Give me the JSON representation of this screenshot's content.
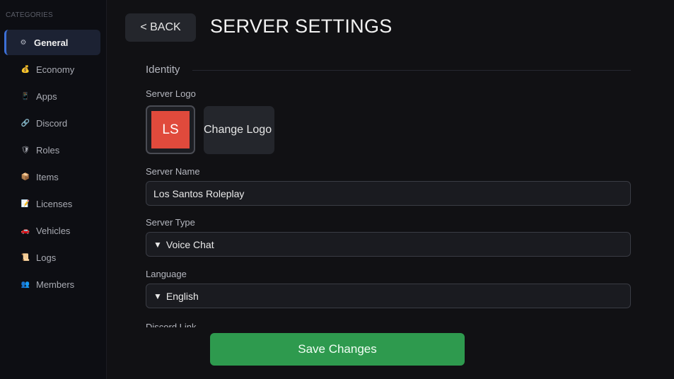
{
  "sidebar": {
    "categories_label": "CATEGORIES",
    "items": [
      {
        "label": "General",
        "icon": "gear-icon",
        "glyph": "⚙",
        "color": "#b8bcc8"
      },
      {
        "label": "Economy",
        "icon": "money-bag-icon",
        "glyph": "💰",
        "color": "#e8b64c"
      },
      {
        "label": "Apps",
        "icon": "phone-icon",
        "glyph": "📱",
        "color": "#9a6fd6"
      },
      {
        "label": "Discord",
        "icon": "link-icon",
        "glyph": "🔗",
        "color": "#9aa0ab"
      },
      {
        "label": "Roles",
        "icon": "shield-icon",
        "glyph": "🛡",
        "color": "#4a9be0"
      },
      {
        "label": "Items",
        "icon": "box-icon",
        "glyph": "📦",
        "color": "#d9a24a"
      },
      {
        "label": "Licenses",
        "icon": "document-icon",
        "glyph": "📝",
        "color": "#e07070"
      },
      {
        "label": "Vehicles",
        "icon": "car-icon",
        "glyph": "🚗",
        "color": "#d8504a"
      },
      {
        "label": "Logs",
        "icon": "scroll-icon",
        "glyph": "📜",
        "color": "#e0c27a"
      },
      {
        "label": "Members",
        "icon": "people-icon",
        "glyph": "👥",
        "color": "#8a6ab8"
      }
    ]
  },
  "header": {
    "back_label": "< BACK",
    "title": "SERVER SETTINGS"
  },
  "identity": {
    "section_title": "Identity",
    "logo_label": "Server Logo",
    "logo_text": "LS",
    "change_logo_label": "Change Logo",
    "server_name_label": "Server Name",
    "server_name_value": "Los Santos Roleplay",
    "server_type_label": "Server Type",
    "server_type_value": "Voice Chat",
    "language_label": "Language",
    "language_value": "English",
    "discord_link_label": "Discord Link"
  },
  "footer": {
    "save_label": "Save Changes"
  },
  "colors": {
    "accent": "#3c6fd6",
    "save": "#2e9a4e",
    "logo_bg": "#e04a3c"
  }
}
